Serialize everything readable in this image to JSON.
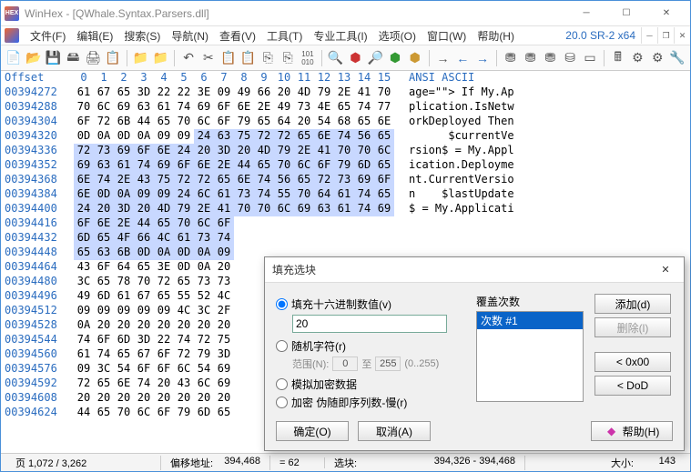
{
  "title": "WinHex - [QWhale.Syntax.Parsers.dll]",
  "version": "20.0 SR-2 x64",
  "menus": [
    "文件(F)",
    "编辑(E)",
    "搜索(S)",
    "导航(N)",
    "查看(V)",
    "工具(T)",
    "专业工具(I)",
    "选项(O)",
    "窗口(W)",
    "帮助(H)"
  ],
  "hex_header": {
    "offset": "Offset",
    "cols": [
      "0",
      "1",
      "2",
      "3",
      "4",
      "5",
      "6",
      "7",
      "8",
      "9",
      "10",
      "11",
      "12",
      "13",
      "14",
      "15"
    ],
    "ascii": "ANSI ASCII"
  },
  "rows": [
    {
      "o": "00394272",
      "b": [
        "61",
        "67",
        "65",
        "3D",
        "22",
        "22",
        "3E",
        "09",
        "49",
        "66",
        "20",
        "4D",
        "79",
        "2E",
        "41",
        "70"
      ],
      "a": "age=\"\"> If My.Ap",
      "sel": []
    },
    {
      "o": "00394288",
      "b": [
        "70",
        "6C",
        "69",
        "63",
        "61",
        "74",
        "69",
        "6F",
        "6E",
        "2E",
        "49",
        "73",
        "4E",
        "65",
        "74",
        "77"
      ],
      "a": "plication.IsNetw",
      "sel": []
    },
    {
      "o": "00394304",
      "b": [
        "6F",
        "72",
        "6B",
        "44",
        "65",
        "70",
        "6C",
        "6F",
        "79",
        "65",
        "64",
        "20",
        "54",
        "68",
        "65",
        "6E"
      ],
      "a": "orkDeployed Then",
      "sel": []
    },
    {
      "o": "00394320",
      "b": [
        "0D",
        "0A",
        "0D",
        "0A",
        "09",
        "09",
        "24",
        "63",
        "75",
        "72",
        "72",
        "65",
        "6E",
        "74",
        "56",
        "65"
      ],
      "a": "      $currentVe",
      "sel": [
        6,
        7,
        8,
        9,
        10,
        11,
        12,
        13,
        14,
        15
      ]
    },
    {
      "o": "00394336",
      "b": [
        "72",
        "73",
        "69",
        "6F",
        "6E",
        "24",
        "20",
        "3D",
        "20",
        "4D",
        "79",
        "2E",
        "41",
        "70",
        "70",
        "6C"
      ],
      "a": "rsion$ = My.Appl",
      "sel": [
        0,
        1,
        2,
        3,
        4,
        5,
        6,
        7,
        8,
        9,
        10,
        11,
        12,
        13,
        14,
        15
      ]
    },
    {
      "o": "00394352",
      "b": [
        "69",
        "63",
        "61",
        "74",
        "69",
        "6F",
        "6E",
        "2E",
        "44",
        "65",
        "70",
        "6C",
        "6F",
        "79",
        "6D",
        "65"
      ],
      "a": "ication.Deployme",
      "sel": [
        0,
        1,
        2,
        3,
        4,
        5,
        6,
        7,
        8,
        9,
        10,
        11,
        12,
        13,
        14,
        15
      ]
    },
    {
      "o": "00394368",
      "b": [
        "6E",
        "74",
        "2E",
        "43",
        "75",
        "72",
        "72",
        "65",
        "6E",
        "74",
        "56",
        "65",
        "72",
        "73",
        "69",
        "6F"
      ],
      "a": "nt.CurrentVersio",
      "sel": [
        0,
        1,
        2,
        3,
        4,
        5,
        6,
        7,
        8,
        9,
        10,
        11,
        12,
        13,
        14,
        15
      ]
    },
    {
      "o": "00394384",
      "b": [
        "6E",
        "0D",
        "0A",
        "09",
        "09",
        "24",
        "6C",
        "61",
        "73",
        "74",
        "55",
        "70",
        "64",
        "61",
        "74",
        "65"
      ],
      "a": "n    $lastUpdate",
      "sel": [
        0,
        1,
        2,
        3,
        4,
        5,
        6,
        7,
        8,
        9,
        10,
        11,
        12,
        13,
        14,
        15
      ]
    },
    {
      "o": "00394400",
      "b": [
        "24",
        "20",
        "3D",
        "20",
        "4D",
        "79",
        "2E",
        "41",
        "70",
        "70",
        "6C",
        "69",
        "63",
        "61",
        "74",
        "69"
      ],
      "a": "$ = My.Applicati",
      "sel": [
        0,
        1,
        2,
        3,
        4,
        5,
        6,
        7,
        8,
        9,
        10,
        11,
        12,
        13,
        14,
        15
      ]
    },
    {
      "o": "00394416",
      "b": [
        "6F",
        "6E",
        "2E",
        "44",
        "65",
        "70",
        "6C",
        "6F"
      ],
      "a": "",
      "sel": [
        0,
        1,
        2,
        3,
        4,
        5,
        6,
        7
      ]
    },
    {
      "o": "00394432",
      "b": [
        "6D",
        "65",
        "4F",
        "66",
        "4C",
        "61",
        "73",
        "74"
      ],
      "a": "",
      "sel": [
        0,
        1,
        2,
        3,
        4,
        5,
        6,
        7
      ]
    },
    {
      "o": "00394448",
      "b": [
        "65",
        "63",
        "6B",
        "0D",
        "0A",
        "0D",
        "0A",
        "09"
      ],
      "a": "",
      "sel": [
        0,
        1,
        2,
        3,
        4,
        5,
        6,
        7
      ]
    },
    {
      "o": "00394464",
      "b": [
        "43",
        "6F",
        "64",
        "65",
        "3E",
        "0D",
        "0A",
        "20"
      ],
      "a": "",
      "sel": []
    },
    {
      "o": "00394480",
      "b": [
        "3C",
        "65",
        "78",
        "70",
        "72",
        "65",
        "73",
        "73"
      ],
      "a": "",
      "sel": []
    },
    {
      "o": "00394496",
      "b": [
        "49",
        "6D",
        "61",
        "67",
        "65",
        "55",
        "52",
        "4C"
      ],
      "a": "",
      "sel": []
    },
    {
      "o": "00394512",
      "b": [
        "09",
        "09",
        "09",
        "09",
        "09",
        "4C",
        "3C",
        "2F"
      ],
      "a": "",
      "sel": []
    },
    {
      "o": "00394528",
      "b": [
        "0A",
        "20",
        "20",
        "20",
        "20",
        "20",
        "20",
        "20"
      ],
      "a": "",
      "sel": []
    },
    {
      "o": "00394544",
      "b": [
        "74",
        "6F",
        "6D",
        "3D",
        "22",
        "74",
        "72",
        "75"
      ],
      "a": "",
      "sel": []
    },
    {
      "o": "00394560",
      "b": [
        "61",
        "74",
        "65",
        "67",
        "6F",
        "72",
        "79",
        "3D"
      ],
      "a": "",
      "sel": []
    },
    {
      "o": "00394576",
      "b": [
        "09",
        "3C",
        "54",
        "6F",
        "6F",
        "6C",
        "54",
        "69"
      ],
      "a": "",
      "sel": []
    },
    {
      "o": "00394592",
      "b": [
        "72",
        "65",
        "6E",
        "74",
        "20",
        "43",
        "6C",
        "69"
      ],
      "a": "",
      "sel": []
    },
    {
      "o": "00394608",
      "b": [
        "20",
        "20",
        "20",
        "20",
        "20",
        "20",
        "20",
        "20"
      ],
      "a": "",
      "sel": []
    },
    {
      "o": "00394624",
      "b": [
        "44",
        "65",
        "70",
        "6C",
        "6F",
        "79",
        "6D",
        "65"
      ],
      "a": "",
      "sel": []
    }
  ],
  "status": {
    "page": "页 1,072 / 3,262",
    "off_label": "偏移地址:",
    "off": "394,468",
    "sel_label": "= 62",
    "sel_label2": "选块:",
    "sel": "394,326 - 394,468",
    "size_label": "大小:",
    "size": "143"
  },
  "dialog": {
    "title": "填充选块",
    "fill_hex": "填充十六进制数值(v)",
    "hex_value": "20",
    "random": "随机字符(r)",
    "range": "范围(N):",
    "range_from": "0",
    "range_to": "255",
    "range_hint": "(0..255)",
    "to": "至",
    "sim": "模拟加密数据",
    "encrypt": "加密 伪随即序列数-慢(r)",
    "overwrite_label": "覆盖次数",
    "pass": "次数 #1",
    "add": "添加(d)",
    "del": "删除(l)",
    "zero": "< 0x00",
    "dod": "< DoD",
    "ok": "确定(O)",
    "cancel": "取消(A)",
    "help": "帮助(H)"
  }
}
